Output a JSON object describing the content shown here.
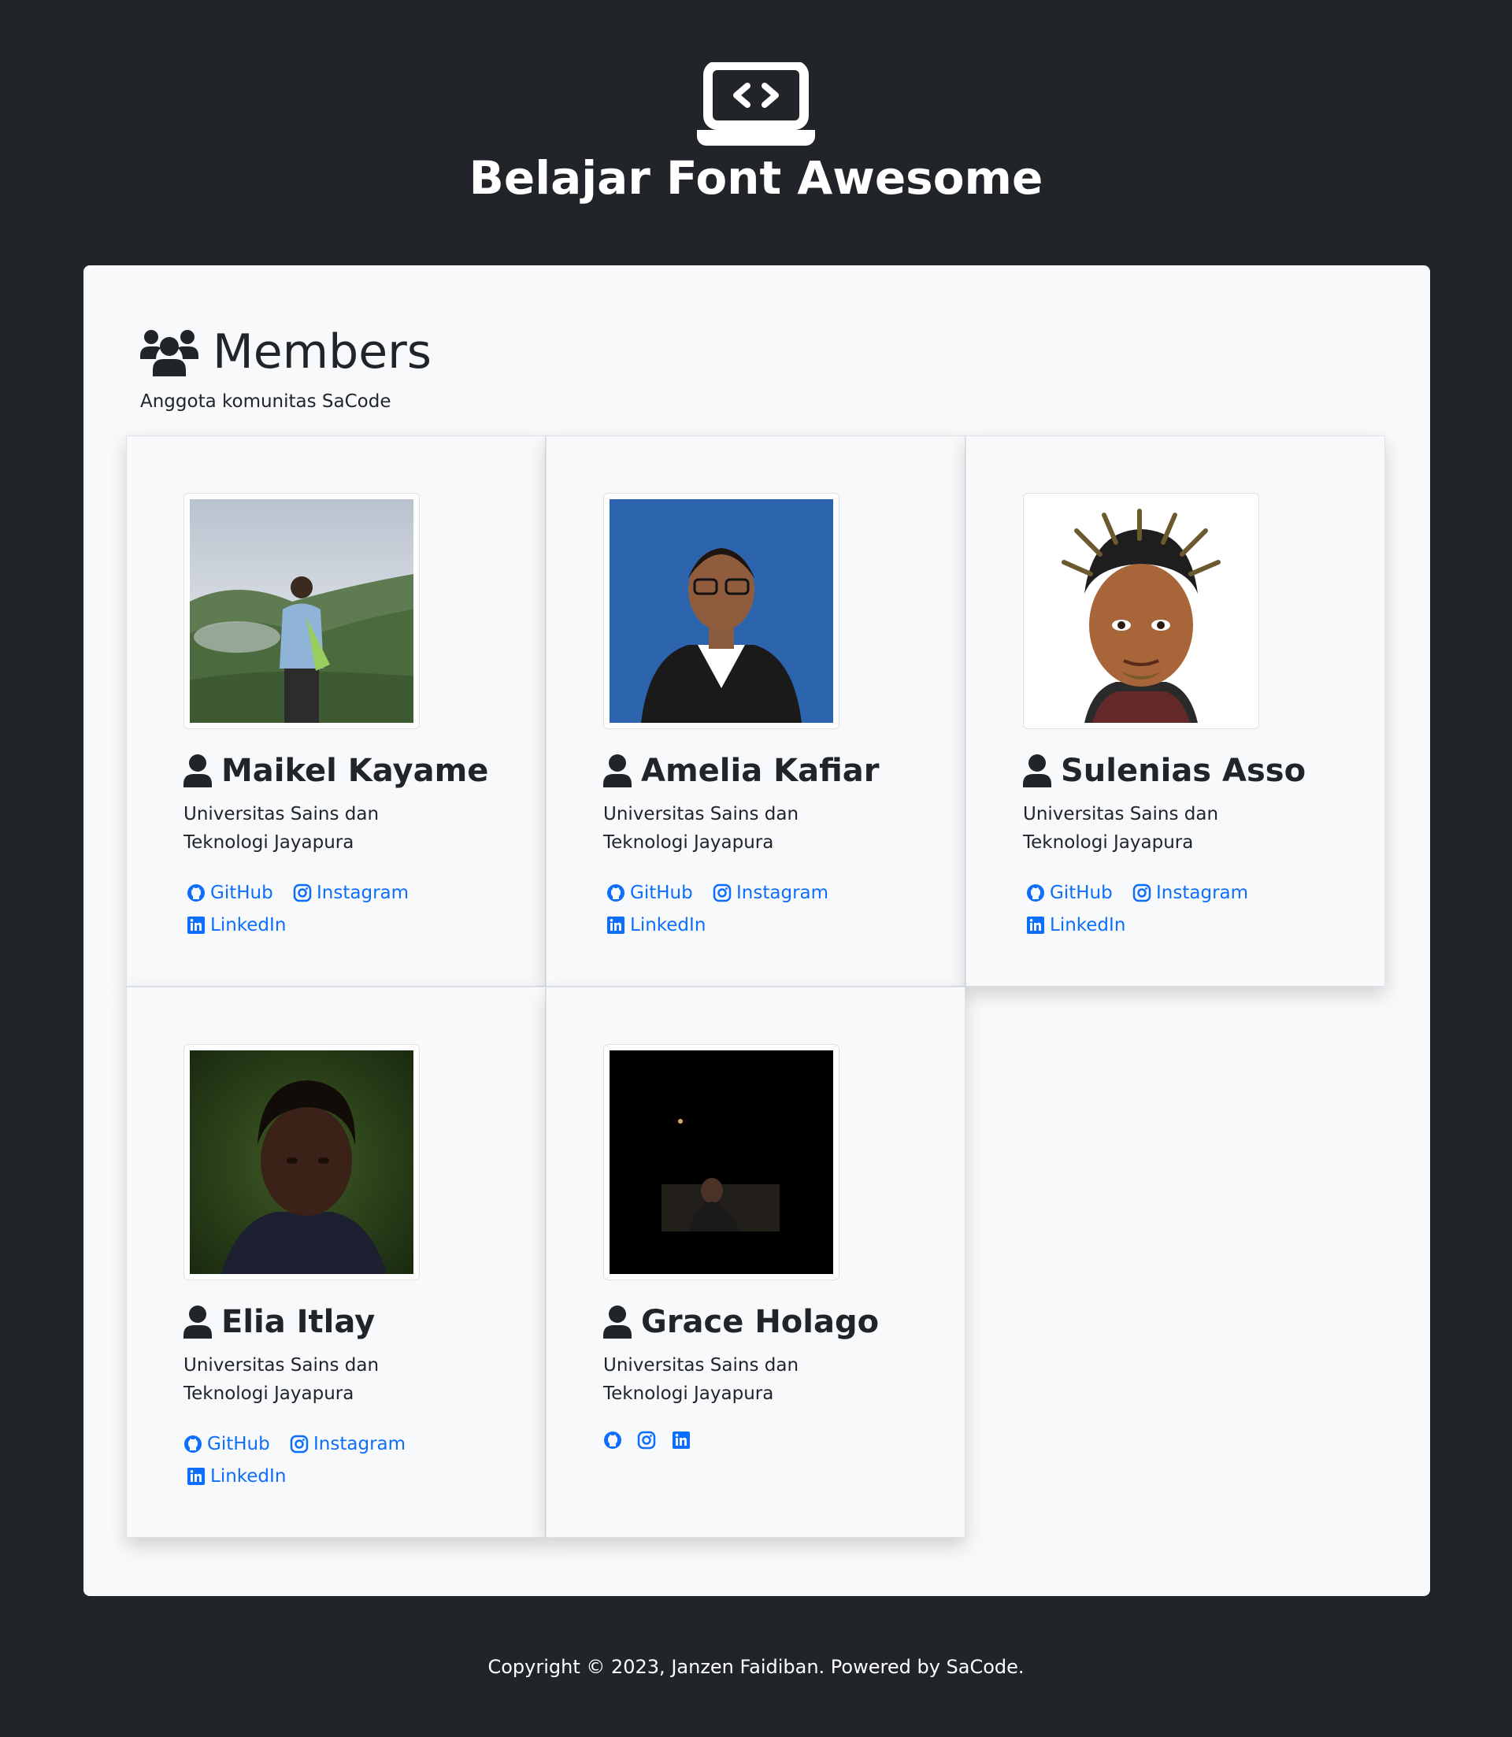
{
  "header": {
    "title": "Belajar Font Awesome",
    "logo_icon": "laptop-code-icon"
  },
  "members_section": {
    "title": "Members",
    "icon": "users-icon",
    "subtitle": "Anggota komunitas SaCode"
  },
  "members": [
    {
      "name": "Maikel Kayame",
      "university": "Universitas Sains dan Teknologi Jayapura",
      "photo": "outdoor-photo-hills",
      "links": {
        "github": "GitHub",
        "instagram": "Instagram",
        "linkedin": "LinkedIn"
      }
    },
    {
      "name": "Amelia Kafiar",
      "university": "Universitas Sains dan Teknologi Jayapura",
      "photo": "formal-portrait-blue-background",
      "links": {
        "github": "GitHub",
        "instagram": "Instagram",
        "linkedin": "LinkedIn"
      }
    },
    {
      "name": "Sulenias Asso",
      "university": "Universitas Sains dan Teknologi Jayapura",
      "photo": "cartoon-avatar-dreadlocks",
      "links": {
        "github": "GitHub",
        "instagram": "Instagram",
        "linkedin": "LinkedIn"
      }
    },
    {
      "name": "Elia Itlay",
      "university": "Universitas Sains dan Teknologi Jayapura",
      "photo": "portrait-green-background",
      "links": {
        "github": "GitHub",
        "instagram": "Instagram",
        "linkedin": "LinkedIn"
      }
    },
    {
      "name": "Grace Holago",
      "university": "Universitas Sains dan Teknologi Jayapura",
      "photo": "dark-night-photo",
      "links": {
        "github": "",
        "instagram": "",
        "linkedin": ""
      }
    }
  ],
  "footer": {
    "text": "Copyright © 2023, Janzen Faidiban. Powered by SaCode."
  },
  "colors": {
    "background": "#212529",
    "panel": "#f8f9fa",
    "link": "#0d6efd",
    "text": "#212529"
  }
}
